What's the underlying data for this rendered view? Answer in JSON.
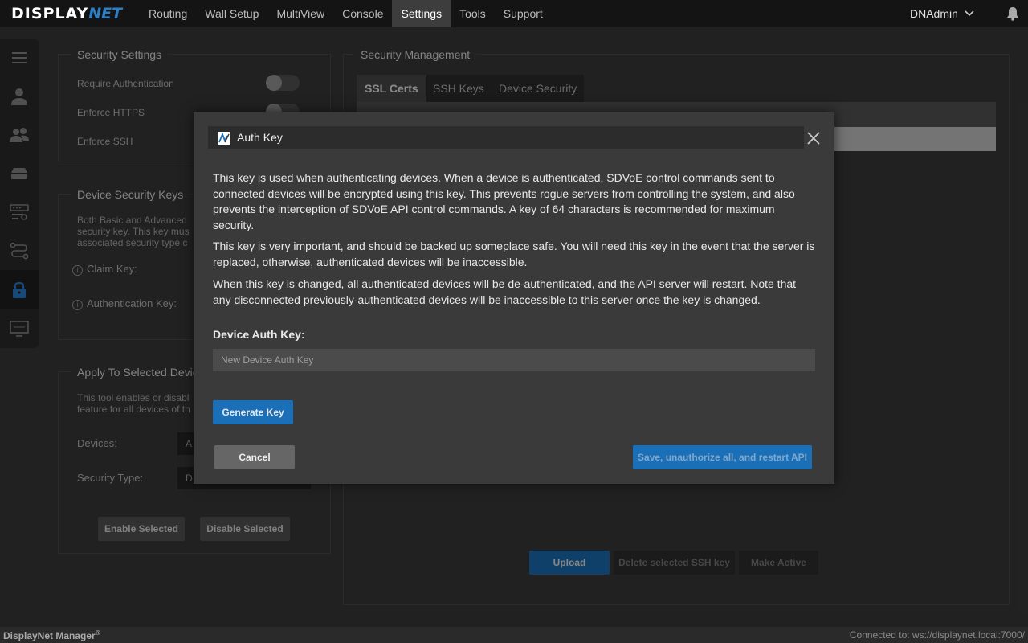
{
  "brand": {
    "display": "DISPLAY",
    "net": "NET"
  },
  "nav": {
    "items": [
      "Routing",
      "Wall Setup",
      "MultiView",
      "Console",
      "Settings",
      "Tools",
      "Support"
    ],
    "active": "Settings"
  },
  "user": {
    "name": "DNAdmin"
  },
  "security_settings": {
    "title": "Security Settings",
    "rows": [
      "Require Authentication",
      "Enforce HTTPS",
      "Enforce SSH"
    ]
  },
  "device_keys": {
    "title": "Device Security Keys",
    "desc_lines": [
      "Both Basic and Advanced",
      "security key. This key mus",
      "associated security type c"
    ],
    "claim_label": "Claim Key:",
    "auth_label": "Authentication Key:"
  },
  "apply": {
    "title": "Apply To Selected Devic",
    "desc_lines": [
      "This tool enables or disabl",
      "feature for all devices of th"
    ],
    "devices_label": "Devices:",
    "devices_value": "A",
    "type_label": "Security Type:",
    "type_value": "D",
    "enable_label": "Enable Selected",
    "disable_label": "Disable Selected"
  },
  "mgmt": {
    "title": "Security Management",
    "tabs": [
      "SSL Certs",
      "SSH Keys",
      "Device Security"
    ],
    "upload_label": "Upload",
    "delete_label": "Delete selected SSH key",
    "make_active_label": "Make Active"
  },
  "modal": {
    "title": "Auth Key",
    "para1": "This key is used when authenticating devices. When a device is authenticated, SDVoE control commands sent to connected devices will be encrypted using this key. This prevents rogue servers from controlling the system, and also prevents the interception of SDVoE API control commands. A key of 64 characters is recommended for maximum security.",
    "para2": "This key is very important, and should be backed up someplace safe. You will need this key in the event that the server is replaced, otherwise, authenticated devices will be inaccessible.",
    "para3": "When this key is changed, all authenticated devices will be de-authenticated, and the API server will restart. Note that any disconnected previously-authenticated devices will be inaccessible to this server once the key is changed.",
    "key_label": "Device Auth Key:",
    "key_placeholder": "New Device Auth Key",
    "key_value": "",
    "generate_label": "Generate Key",
    "cancel_label": "Cancel",
    "save_label": "Save, unauthorize all, and restart API"
  },
  "footer": {
    "app_name": "DisplayNet Manager",
    "reg": "®",
    "status": "Connected to: ws://displaynet.local:7000/"
  },
  "colors": {
    "accent": "#1b6fb6",
    "topbar": "#141414",
    "background": "#3a3a3a"
  },
  "icons": [
    "menu-icon",
    "user-icon",
    "users-icon",
    "device-icon",
    "rack-settings-icon",
    "routing-icon",
    "lock-icon",
    "display-icon",
    "bell-icon",
    "chevron-down-icon",
    "close-icon"
  ]
}
